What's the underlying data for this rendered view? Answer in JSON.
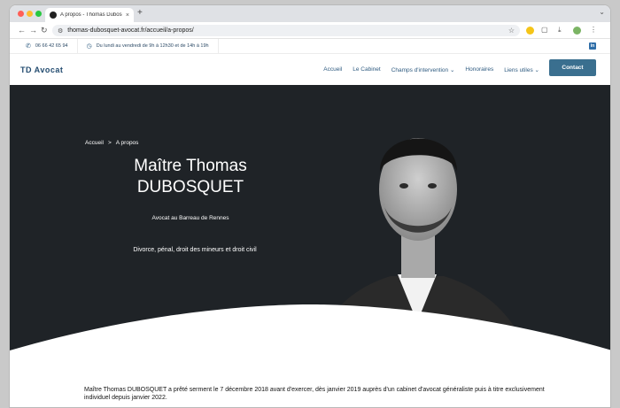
{
  "browser": {
    "tab_title": "A propos - Thomas Dubosquet",
    "tab_close": "×",
    "new_tab": "+",
    "tab_menu": "⌄",
    "back": "←",
    "forward": "→",
    "reload": "↻",
    "url": "thomas-dubosquet-avocat.fr/accueil/a-propos/",
    "star": "☆",
    "menu": "⋮"
  },
  "topbar": {
    "phone": "06 66 42 65 94",
    "hours": "Du lundi au vendredi de 9h à 12h30 et de 14h à 19h",
    "linkedin": "in"
  },
  "header": {
    "logo": "TD Avocat",
    "menu": {
      "accueil": "Accueil",
      "cabinet": "Le Cabinet",
      "champs": "Champs d'intervention ⌄",
      "honoraires": "Honoraires",
      "liens": "Liens utiles ⌄"
    },
    "contact": "Contact"
  },
  "hero": {
    "breadcrumb_home": "Accueil",
    "breadcrumb_sep": ">",
    "breadcrumb_current": "A propos",
    "title_line1": "Maître Thomas",
    "title_line2": "DUBOSQUET",
    "subtitle": "Avocat au Barreau de Rennes",
    "tagline": "Divorce, pénal, droit des mineurs et droit civil"
  },
  "intro": {
    "text": "Maître Thomas DUBOSQUET a prêté serment le 7 décembre 2018 avant d'exercer, dès janvier 2019 auprès d'un cabinet d'avocat généraliste puis à titre exclusivement individuel depuis janvier 2022."
  },
  "colors": {
    "accent": "#3a6f8f",
    "navy": "#234c70",
    "hero_bg": "#1f2327"
  }
}
